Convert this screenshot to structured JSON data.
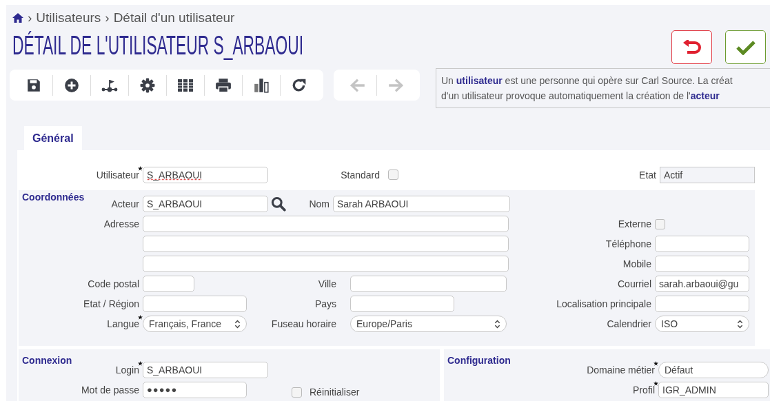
{
  "breadcrumb": {
    "separator": "›",
    "items": [
      "Utilisateurs",
      "Détail d'un utilisateur"
    ]
  },
  "title": "DÉTAIL DE L'UTILISATEUR S_ARBAOUI",
  "actions": [
    {
      "kind": "undo"
    },
    {
      "kind": "confirm"
    }
  ],
  "toolbar": [
    {
      "kind": "save"
    },
    {
      "kind": "add"
    },
    {
      "kind": "flag"
    },
    {
      "kind": "settings"
    },
    {
      "kind": "binders"
    },
    {
      "kind": "print"
    },
    {
      "kind": "chart"
    },
    {
      "kind": "refresh"
    }
  ],
  "nav": [
    {
      "kind": "back",
      "disabled": true
    },
    {
      "kind": "forward",
      "disabled": true
    }
  ],
  "info": [
    "Un **utilisateur** est une personne qui opère sur Carl Source. La créat",
    "d'un utilisateur provoque automatiquement la création de l'**acteur**"
  ],
  "tabs": [
    {
      "label": "Général",
      "selected": true
    }
  ],
  "general": {
    "user": {
      "label": "Utilisateur",
      "value": "S_ARBAOUI",
      "required": true
    },
    "standard": {
      "label": "Standard",
      "checked": false
    },
    "state": {
      "label": "Etat",
      "value": "Actif"
    }
  },
  "contact": {
    "title": "Coordonnées",
    "actor": {
      "label": "Acteur",
      "value": "S_ARBAOUI"
    },
    "name": {
      "label": "Nom",
      "value": "Sarah ARBAOUI"
    },
    "address": {
      "label": "Adresse"
    },
    "external": {
      "label": "Externe",
      "checked": false
    },
    "phone": {
      "label": "Téléphone"
    },
    "mobile": {
      "label": "Mobile"
    },
    "zip": {
      "label": "Code postal"
    },
    "city": {
      "label": "Ville"
    },
    "email": {
      "label": "Courriel",
      "value": "sarah.arbaoui@gu"
    },
    "region": {
      "label": "Etat / Région"
    },
    "country": {
      "label": "Pays"
    },
    "location": {
      "label": "Localisation principale"
    },
    "language": {
      "label": "Langue",
      "value": "Français, France",
      "required": true
    },
    "timezone": {
      "label": "Fuseau horaire",
      "value": "Europe/Paris"
    },
    "calendar": {
      "label": "Calendrier",
      "value": "ISO"
    }
  },
  "login": {
    "title": "Connexion",
    "login": {
      "label": "Login",
      "value": "S_ARBAOUI",
      "required": true
    },
    "password": {
      "label": "Mot de passe",
      "value": "●●●●●"
    },
    "reset": {
      "label": "Réinitialiser",
      "checked": false
    }
  },
  "config": {
    "title": "Configuration",
    "domain": {
      "label": "Domaine métier",
      "value": "Défaut",
      "required": true
    },
    "profile": {
      "label": "Profil",
      "value": "IGR_ADMIN",
      "required": true
    }
  }
}
